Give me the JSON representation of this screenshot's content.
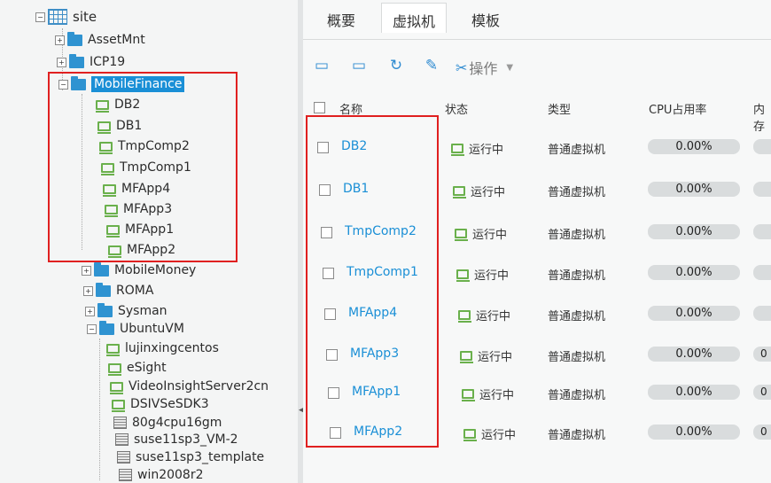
{
  "tree": {
    "root": "site",
    "folders_top": [
      "AssetMnt",
      "ICP19"
    ],
    "selected_folder": "MobileFinance",
    "selected_children": [
      "DB2",
      "DB1",
      "TmpComp2",
      "TmpComp1",
      "MFApp4",
      "MFApp3",
      "MFApp1",
      "MFApp2"
    ],
    "folders_bottom": [
      "MobileMoney",
      "ROMA",
      "Sysman",
      "UbuntuVM"
    ],
    "ubuntu_vms": [
      "lujinxingcentos",
      "eSight",
      "VideoInsightServer2cn",
      "DSIVSeSDK3"
    ],
    "templates": [
      "80g4cpu16gm",
      "suse11sp3_VM-2",
      "suse11sp3_template",
      "win2008r2"
    ]
  },
  "tabs": [
    "概要",
    "虚拟机",
    "模板"
  ],
  "active_tab_index": 1,
  "toolbar": {
    "icons": [
      "create-vm-icon",
      "import-vm-icon",
      "refresh-icon",
      "export-icon"
    ],
    "ops_label": "操作"
  },
  "table": {
    "headers": {
      "name": "名称",
      "status": "状态",
      "type": "类型",
      "cpu": "CPU占用率",
      "mem": "内存"
    },
    "rows": [
      {
        "name": "DB2",
        "status": "运行中",
        "type": "普通虚拟机",
        "cpu": "0.00%",
        "mem": ""
      },
      {
        "name": "DB1",
        "status": "运行中",
        "type": "普通虚拟机",
        "cpu": "0.00%",
        "mem": ""
      },
      {
        "name": "TmpComp2",
        "status": "运行中",
        "type": "普通虚拟机",
        "cpu": "0.00%",
        "mem": ""
      },
      {
        "name": "TmpComp1",
        "status": "运行中",
        "type": "普通虚拟机",
        "cpu": "0.00%",
        "mem": ""
      },
      {
        "name": "MFApp4",
        "status": "运行中",
        "type": "普通虚拟机",
        "cpu": "0.00%",
        "mem": ""
      },
      {
        "name": "MFApp3",
        "status": "运行中",
        "type": "普通虚拟机",
        "cpu": "0.00%",
        "mem": "0"
      },
      {
        "name": "MFApp1",
        "status": "运行中",
        "type": "普通虚拟机",
        "cpu": "0.00%",
        "mem": "0"
      },
      {
        "name": "MFApp2",
        "status": "运行中",
        "type": "普通虚拟机",
        "cpu": "0.00%",
        "mem": "0"
      }
    ]
  },
  "colors": {
    "accent": "#1a8fd6",
    "running": "#6ab04c",
    "highlight": "#e02020"
  }
}
